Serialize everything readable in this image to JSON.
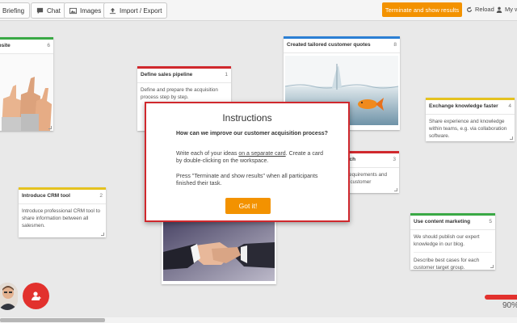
{
  "toolbar": {
    "briefing": "Briefing",
    "chat": "Chat",
    "images": "Images",
    "import_export": "Import / Export",
    "terminate": "Terminate and show results",
    "reload": "Reload",
    "my_w": "My w"
  },
  "cards": {
    "website": {
      "title": "ebsite",
      "count": "6"
    },
    "pipeline": {
      "title": "Define sales pipeline",
      "count": "1",
      "body": "Define and prepare the acquisition process step by step."
    },
    "quotes": {
      "title": "Created tailored customer quotes",
      "count": "8"
    },
    "exchange": {
      "title": "Exchange knowledge faster",
      "count": "4",
      "body": "Share experience and knowledge within teams, e.g. via collaboration software."
    },
    "research": {
      "title": "rch",
      "count": "3",
      "body1": "requirements and",
      "body2": "t customer"
    },
    "crm": {
      "title": "Introduce CRM tool",
      "count": "2",
      "body": "Introduce professional CRM tool to share information between all salesmen."
    },
    "content": {
      "title": "Use content marketing",
      "count": "5",
      "body1": "We should publish our expert knowledge in our blog.",
      "body2": "Describe best cases for each customer target group."
    }
  },
  "modal": {
    "title": "Instructions",
    "question": "How can we improve our customer acquisition process?",
    "p1_before": "Write each of your ideas ",
    "p1_link": "on a separate card",
    "p1_after": ". Create a card by double-clicking on the workspace.",
    "p2": "Press \"Terminate and show results\" when all participants finished their task.",
    "button": "Got it!"
  },
  "zoom": "90%",
  "colors": {
    "accent": "#f39200",
    "danger": "#e2312d",
    "green": "#3aa945",
    "yellow": "#e5c21f",
    "blue": "#2b7fd4"
  }
}
